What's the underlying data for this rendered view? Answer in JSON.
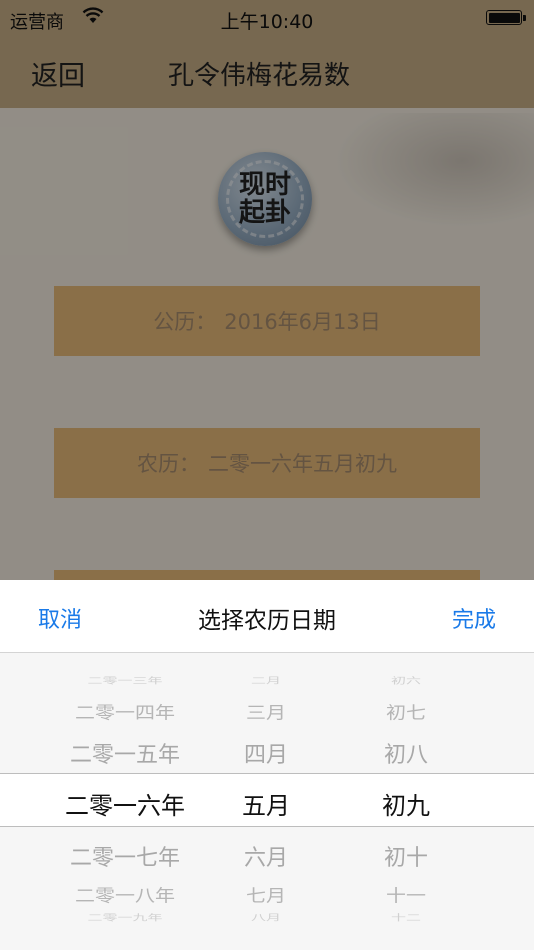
{
  "status_bar": {
    "carrier": "运营商",
    "time": "上午10:40"
  },
  "nav": {
    "back_label": "返回",
    "title": "孔令伟梅花易数"
  },
  "qi_button": {
    "line1": "现时",
    "line2": "起卦"
  },
  "fields": {
    "solar_label": "公历：",
    "solar_value": "2016年6月13日",
    "lunar_label": "农历：",
    "lunar_value": "二零一六年五月初九"
  },
  "picker": {
    "cancel_label": "取消",
    "title": "选择农历日期",
    "done_label": "完成",
    "years": [
      "二零一三年",
      "二零一四年",
      "二零一五年",
      "二零一六年",
      "二零一七年",
      "二零一八年",
      "二零一九年"
    ],
    "months": [
      "二月",
      "三月",
      "四月",
      "五月",
      "六月",
      "七月",
      "八月"
    ],
    "days": [
      "初六",
      "初七",
      "初八",
      "初九",
      "初十",
      "十一",
      "十二"
    ]
  }
}
